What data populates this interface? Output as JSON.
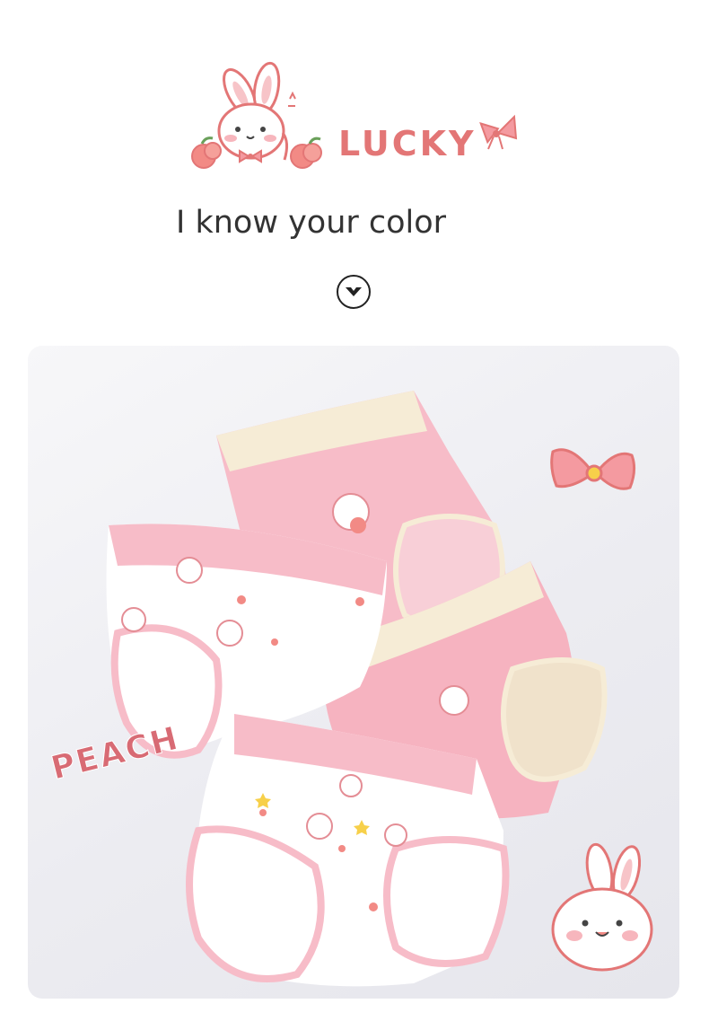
{
  "header": {
    "logo_text": "LUCKY",
    "tagline": "I know your color",
    "scroll_icon": "chevron-down-circle-icon"
  },
  "photo": {
    "badge_text": "PEACH",
    "colors": {
      "pink": "#f7bcc8",
      "cream": "#f6ecd6",
      "white": "#ffffff",
      "accent": "#e37676"
    }
  }
}
